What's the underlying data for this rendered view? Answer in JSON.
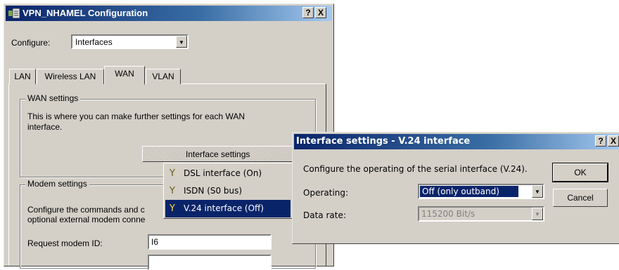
{
  "main_window": {
    "title": "VPN_NHAMEL Configuration",
    "help_label": "?",
    "close_label": "X",
    "configure_label": "Configure:",
    "configure_value": "Interfaces",
    "tabs": [
      {
        "label": "LAN"
      },
      {
        "label": "Wireless LAN"
      },
      {
        "label": "WAN"
      },
      {
        "label": "VLAN"
      }
    ],
    "wan_settings": {
      "label": "WAN settings",
      "description": "This is where you can make further settings for each WAN interface.",
      "button_label": "Interface settings"
    },
    "modem_settings": {
      "label": "Modem settings",
      "description_line1": "Configure the commands and c",
      "description_line2": "optional external modem conne",
      "request_modem_id_label": "Request modem ID:",
      "request_modem_id_value": "I6",
      "next_field_value": ""
    }
  },
  "interface_menu": {
    "items": [
      {
        "label": "DSL interface (On)"
      },
      {
        "label": "ISDN (S0 bus)"
      },
      {
        "label": "V.24 interface (Off)"
      }
    ],
    "selected_index": 2
  },
  "dialog": {
    "title": "Interface settings - V.24 interface",
    "help_label": "?",
    "close_label": "X",
    "description": "Configure the operating of the serial interface (V.24).",
    "operating_label": "Operating:",
    "operating_value": "Off (only outband)",
    "data_rate_label": "Data rate:",
    "data_rate_value": "115200 Bit/s",
    "ok_label": "OK",
    "cancel_label": "Cancel"
  },
  "colors": {
    "title_active": "#0a246a",
    "selection": "#0a246a",
    "face": "#d4d0c8"
  }
}
